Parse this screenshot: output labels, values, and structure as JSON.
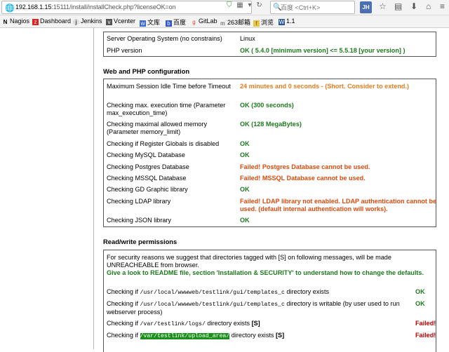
{
  "browser": {
    "url_host": "192.168.1.15",
    "url_path": ":15111/install/installCheck.php?licenseOK=on",
    "search_placeholder": "百度 <Ctrl+K>",
    "addon_badge": "JH",
    "bookmarks": [
      {
        "label": "Nagios",
        "icon": "N"
      },
      {
        "label": "Dashboard",
        "icon": "z"
      },
      {
        "label": "Jenkins",
        "icon": "j"
      },
      {
        "label": "Vcenter",
        "icon": "v"
      },
      {
        "label": "文库",
        "icon": "w"
      },
      {
        "label": "百度",
        "icon": "b"
      },
      {
        "label": "GitLab",
        "icon": "g"
      },
      {
        "label": "263邮箱",
        "icon": "m"
      },
      {
        "label": "浏览",
        "icon": "f"
      },
      {
        "label": "1.1",
        "icon": "W"
      }
    ]
  },
  "server_box": {
    "rows": [
      {
        "label": "Server Operating System (no constrains)",
        "value": "Linux",
        "status": "plain"
      },
      {
        "label": "PHP version",
        "value": "OK ( 5.4.0 [minimum version] <= 5.5.18 [your version] )",
        "status": "ok"
      }
    ]
  },
  "web_php": {
    "heading": "Web and PHP configuration",
    "rows": [
      {
        "label": "Maximum Session Idle Time before Timeout",
        "value": "24 minutes and 0 seconds - (Short. Consider to extend.)",
        "status": "warn"
      },
      {
        "label": "Checking max. execution time (Parameter max_execution_time)",
        "value": "OK (300 seconds)",
        "status": "ok"
      },
      {
        "label": "Checking maximal allowed memory (Parameter memory_limit)",
        "value": "OK (128 MegaBytes)",
        "status": "ok"
      },
      {
        "label": "Checking if Register Globals is disabled",
        "value": "OK",
        "status": "ok"
      },
      {
        "label": "Checking MySQL Database",
        "value": "OK",
        "status": "ok"
      },
      {
        "label": "Checking Postgres Database",
        "value": "Failed! Postgres Database cannot be used.",
        "status": "fail"
      },
      {
        "label": "Checking MSSQL Database",
        "value": "Failed! MSSQL Database cannot be used.",
        "status": "fail"
      },
      {
        "label": "Checking GD Graphic library",
        "value": "OK",
        "status": "ok"
      },
      {
        "label": "Checking LDAP library",
        "value": "Failed! LDAP library not enabled. LDAP authentication cannot be used. (default internal authentication will works).",
        "status": "fail"
      },
      {
        "label": "Checking JSON library",
        "value": "OK",
        "status": "ok"
      }
    ]
  },
  "rw": {
    "heading": "Read/write permissions",
    "intro": "For security reasons we suggest that directories tagged with [S] on following messages, will be made UNREACHEABLE from browser.",
    "readme": "Give a look to README file, section 'Installation & SECURITY' to understand how to change the defaults.",
    "checks": [
      {
        "pre": "Checking if ",
        "path": "/usr/local/wwwweb/testlink/gui/templates_c",
        "post": " directory exists",
        "tag": "",
        "status": "OK",
        "cls": "ok"
      },
      {
        "pre": "Checking if ",
        "path": "/usr/local/wwwweb/testlink/gui/templates_c",
        "post": " directory is writable (by user used to run webserver process)",
        "tag": "",
        "status": "OK",
        "cls": "ok"
      },
      {
        "pre": "Checking if ",
        "path": "/var/testlink/logs/",
        "post": " directory exists ",
        "tag": "[S]",
        "status": "Failed!",
        "cls": "red"
      },
      {
        "pre": "Checking if ",
        "path": "/var/testlink/upload_area/",
        "post": " directory exists ",
        "tag": "[S]",
        "status": "Failed!",
        "cls": "red"
      }
    ]
  }
}
